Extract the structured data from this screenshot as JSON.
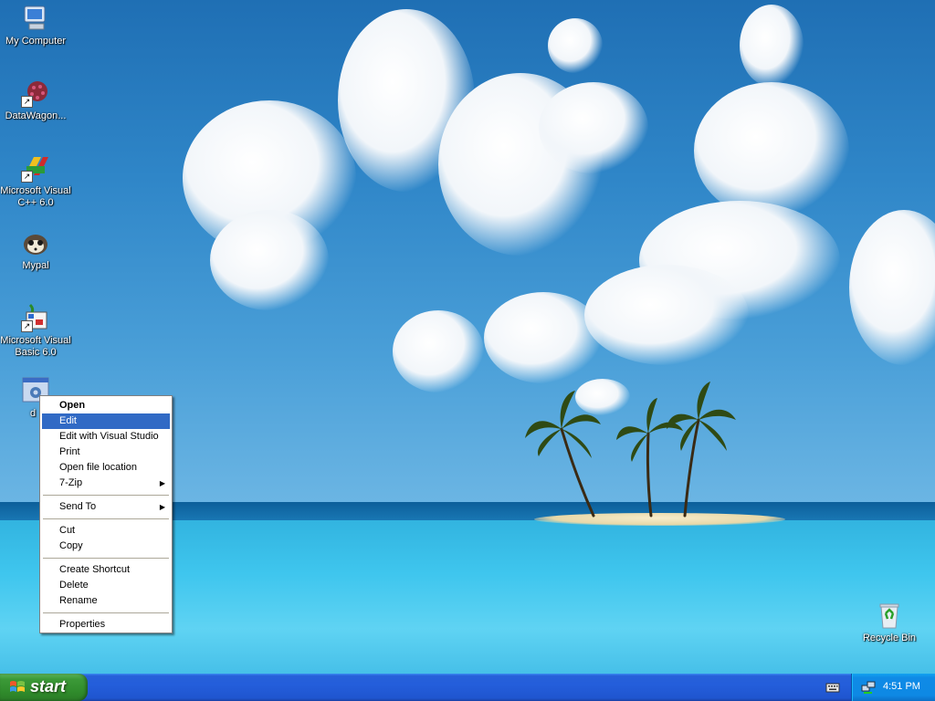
{
  "desktop": {
    "icons": [
      {
        "label": "My Computer",
        "icon": "my-computer-icon"
      },
      {
        "label": "DataWagon...",
        "icon": "datawagon-icon"
      },
      {
        "label": "Microsoft Visual C++ 6.0",
        "icon": "visual-cpp-icon"
      },
      {
        "label": "Mypal",
        "icon": "mypal-icon"
      },
      {
        "label": "Microsoft Visual Basic 6.0",
        "icon": "visual-basic-icon"
      },
      {
        "label": "d",
        "icon": "settings-file-icon"
      },
      {
        "label": "Recycle Bin",
        "icon": "recycle-bin-icon"
      }
    ]
  },
  "context_menu": {
    "items": [
      {
        "label": "Open"
      },
      {
        "label": "Edit"
      },
      {
        "label": "Edit with Visual Studio"
      },
      {
        "label": "Print"
      },
      {
        "label": "Open file location"
      },
      {
        "label": "7-Zip"
      },
      {
        "label": "Send To"
      },
      {
        "label": "Cut"
      },
      {
        "label": "Copy"
      },
      {
        "label": "Create Shortcut"
      },
      {
        "label": "Delete"
      },
      {
        "label": "Rename"
      },
      {
        "label": "Properties"
      }
    ],
    "submenu_arrow": "▶"
  },
  "taskbar": {
    "start_label": "start",
    "clock": "4:51 PM"
  },
  "colors": {
    "menu_highlight": "#316ac5",
    "taskbar_blue": "#245edb",
    "start_green": "#3c9a38",
    "tray_blue": "#0f8ae6"
  }
}
